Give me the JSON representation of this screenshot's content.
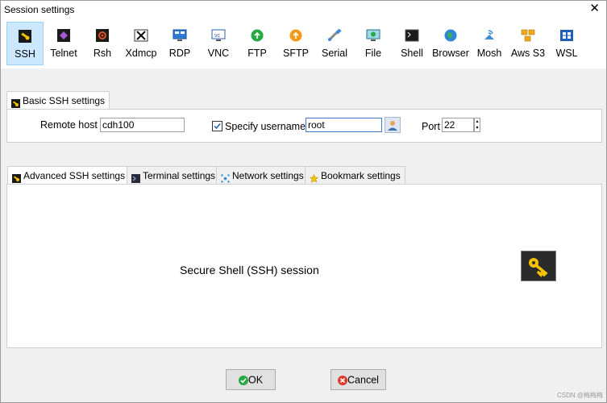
{
  "window": {
    "title": "Session settings",
    "close_glyph": "✕"
  },
  "protocols": [
    {
      "label": "SSH",
      "icon": "ssh-icon",
      "selected": true
    },
    {
      "label": "Telnet",
      "icon": "telnet-icon"
    },
    {
      "label": "Rsh",
      "icon": "rsh-icon"
    },
    {
      "label": "Xdmcp",
      "icon": "xdmcp-icon"
    },
    {
      "label": "RDP",
      "icon": "rdp-icon"
    },
    {
      "label": "VNC",
      "icon": "vnc-icon"
    },
    {
      "label": "FTP",
      "icon": "ftp-icon"
    },
    {
      "label": "SFTP",
      "icon": "sftp-icon"
    },
    {
      "label": "Serial",
      "icon": "serial-icon"
    },
    {
      "label": "File",
      "icon": "file-icon"
    },
    {
      "label": "Shell",
      "icon": "shell-icon"
    },
    {
      "label": "Browser",
      "icon": "browser-icon"
    },
    {
      "label": "Mosh",
      "icon": "mosh-icon"
    },
    {
      "label": "Aws S3",
      "icon": "aws-s3-icon"
    },
    {
      "label": "WSL",
      "icon": "wsl-icon"
    }
  ],
  "basic": {
    "tab_label": "Basic SSH settings",
    "remote_host_label": "Remote host *",
    "remote_host_value": "cdh100",
    "specify_username_label": "Specify username",
    "specify_username_checked": true,
    "username_value": "root",
    "port_label": "Port",
    "port_value": "22"
  },
  "subtabs": [
    {
      "label": "Advanced SSH settings",
      "icon": "ssh-small-icon"
    },
    {
      "label": "Terminal settings",
      "icon": "terminal-icon"
    },
    {
      "label": "Network settings",
      "icon": "network-icon"
    },
    {
      "label": "Bookmark settings",
      "icon": "star-icon"
    }
  ],
  "content": {
    "description": "Secure Shell (SSH) session",
    "icon": "key-icon"
  },
  "buttons": {
    "ok_label": "OK",
    "cancel_label": "Cancel"
  },
  "watermark": "CSDN @梅梅梅"
}
